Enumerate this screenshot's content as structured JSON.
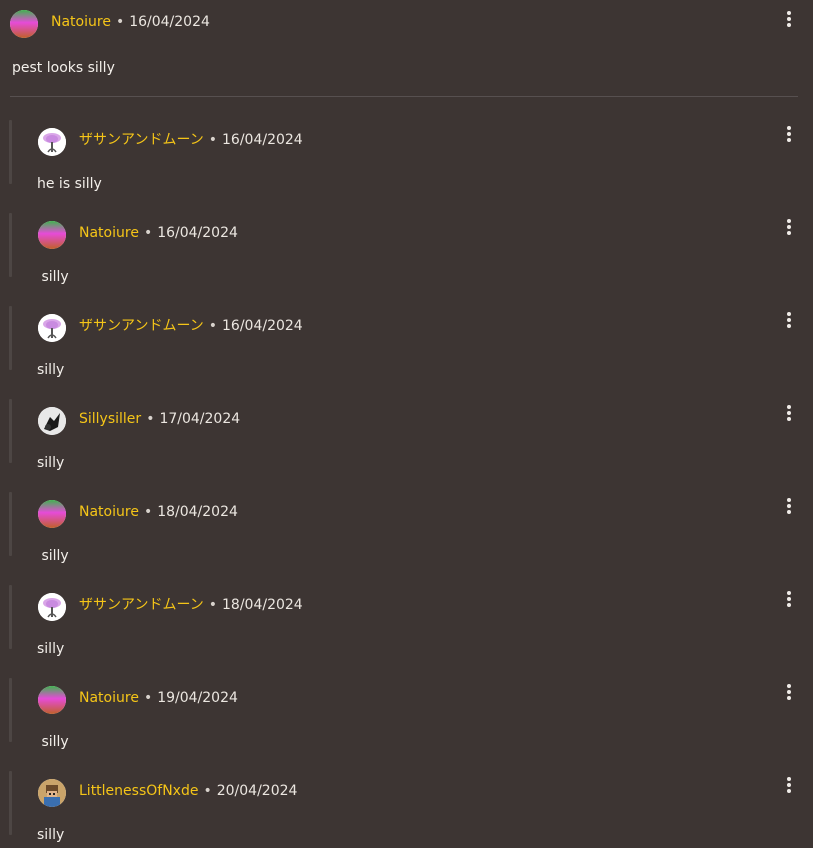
{
  "separator": "•",
  "top": {
    "username": "Natoiure",
    "date": "16/04/2024",
    "text": "pest looks silly",
    "avatar_icon": "gradient-circle-avatar"
  },
  "replies": [
    {
      "username": "ザサンアンドムーン",
      "date": "16/04/2024",
      "text": "he is silly",
      "avatar_icon": "lavender-flower-avatar"
    },
    {
      "username": "Natoiure",
      "date": "16/04/2024",
      "text": " silly",
      "avatar_icon": "gradient-circle-avatar"
    },
    {
      "username": "ザサンアンドムーン",
      "date": "16/04/2024",
      "text": "silly",
      "avatar_icon": "lavender-flower-avatar"
    },
    {
      "username": "Sillysiller",
      "date": "17/04/2024",
      "text": "silly",
      "avatar_icon": "bw-figure-avatar"
    },
    {
      "username": "Natoiure",
      "date": "18/04/2024",
      "text": " silly",
      "avatar_icon": "gradient-circle-avatar"
    },
    {
      "username": "ザサンアンドムーン",
      "date": "18/04/2024",
      "text": "silly",
      "avatar_icon": "lavender-flower-avatar"
    },
    {
      "username": "Natoiure",
      "date": "19/04/2024",
      "text": " silly",
      "avatar_icon": "gradient-circle-avatar"
    },
    {
      "username": "LittlenessOfNxde",
      "date": "20/04/2024",
      "text": "silly",
      "avatar_icon": "pixel-character-avatar"
    }
  ],
  "colors": {
    "background": "#3d3533",
    "username": "#f5c518",
    "text": "#f0ece8"
  }
}
